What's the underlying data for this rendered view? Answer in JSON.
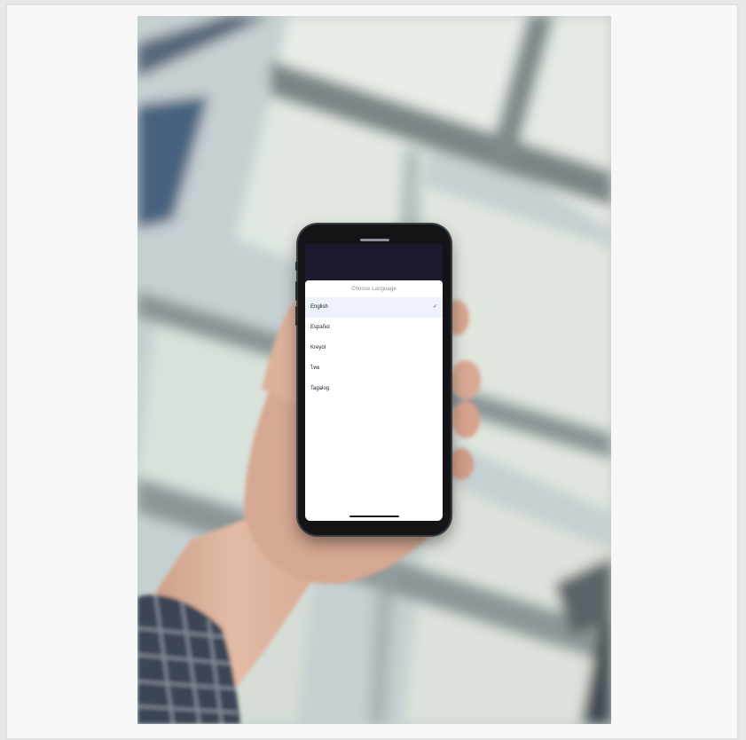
{
  "sheet": {
    "title": "Choose Language",
    "check_glyph": "✓",
    "languages": [
      {
        "label": "English",
        "selected": true
      },
      {
        "label": "Español",
        "selected": false
      },
      {
        "label": "Kreyòl",
        "selected": false
      },
      {
        "label": "ไทย",
        "selected": false
      },
      {
        "label": "Tagalog",
        "selected": false
      }
    ]
  },
  "colors": {
    "selected_row": "#eef2fb",
    "screen_header": "#1c1a2f",
    "frame": "#f7f7f7"
  }
}
